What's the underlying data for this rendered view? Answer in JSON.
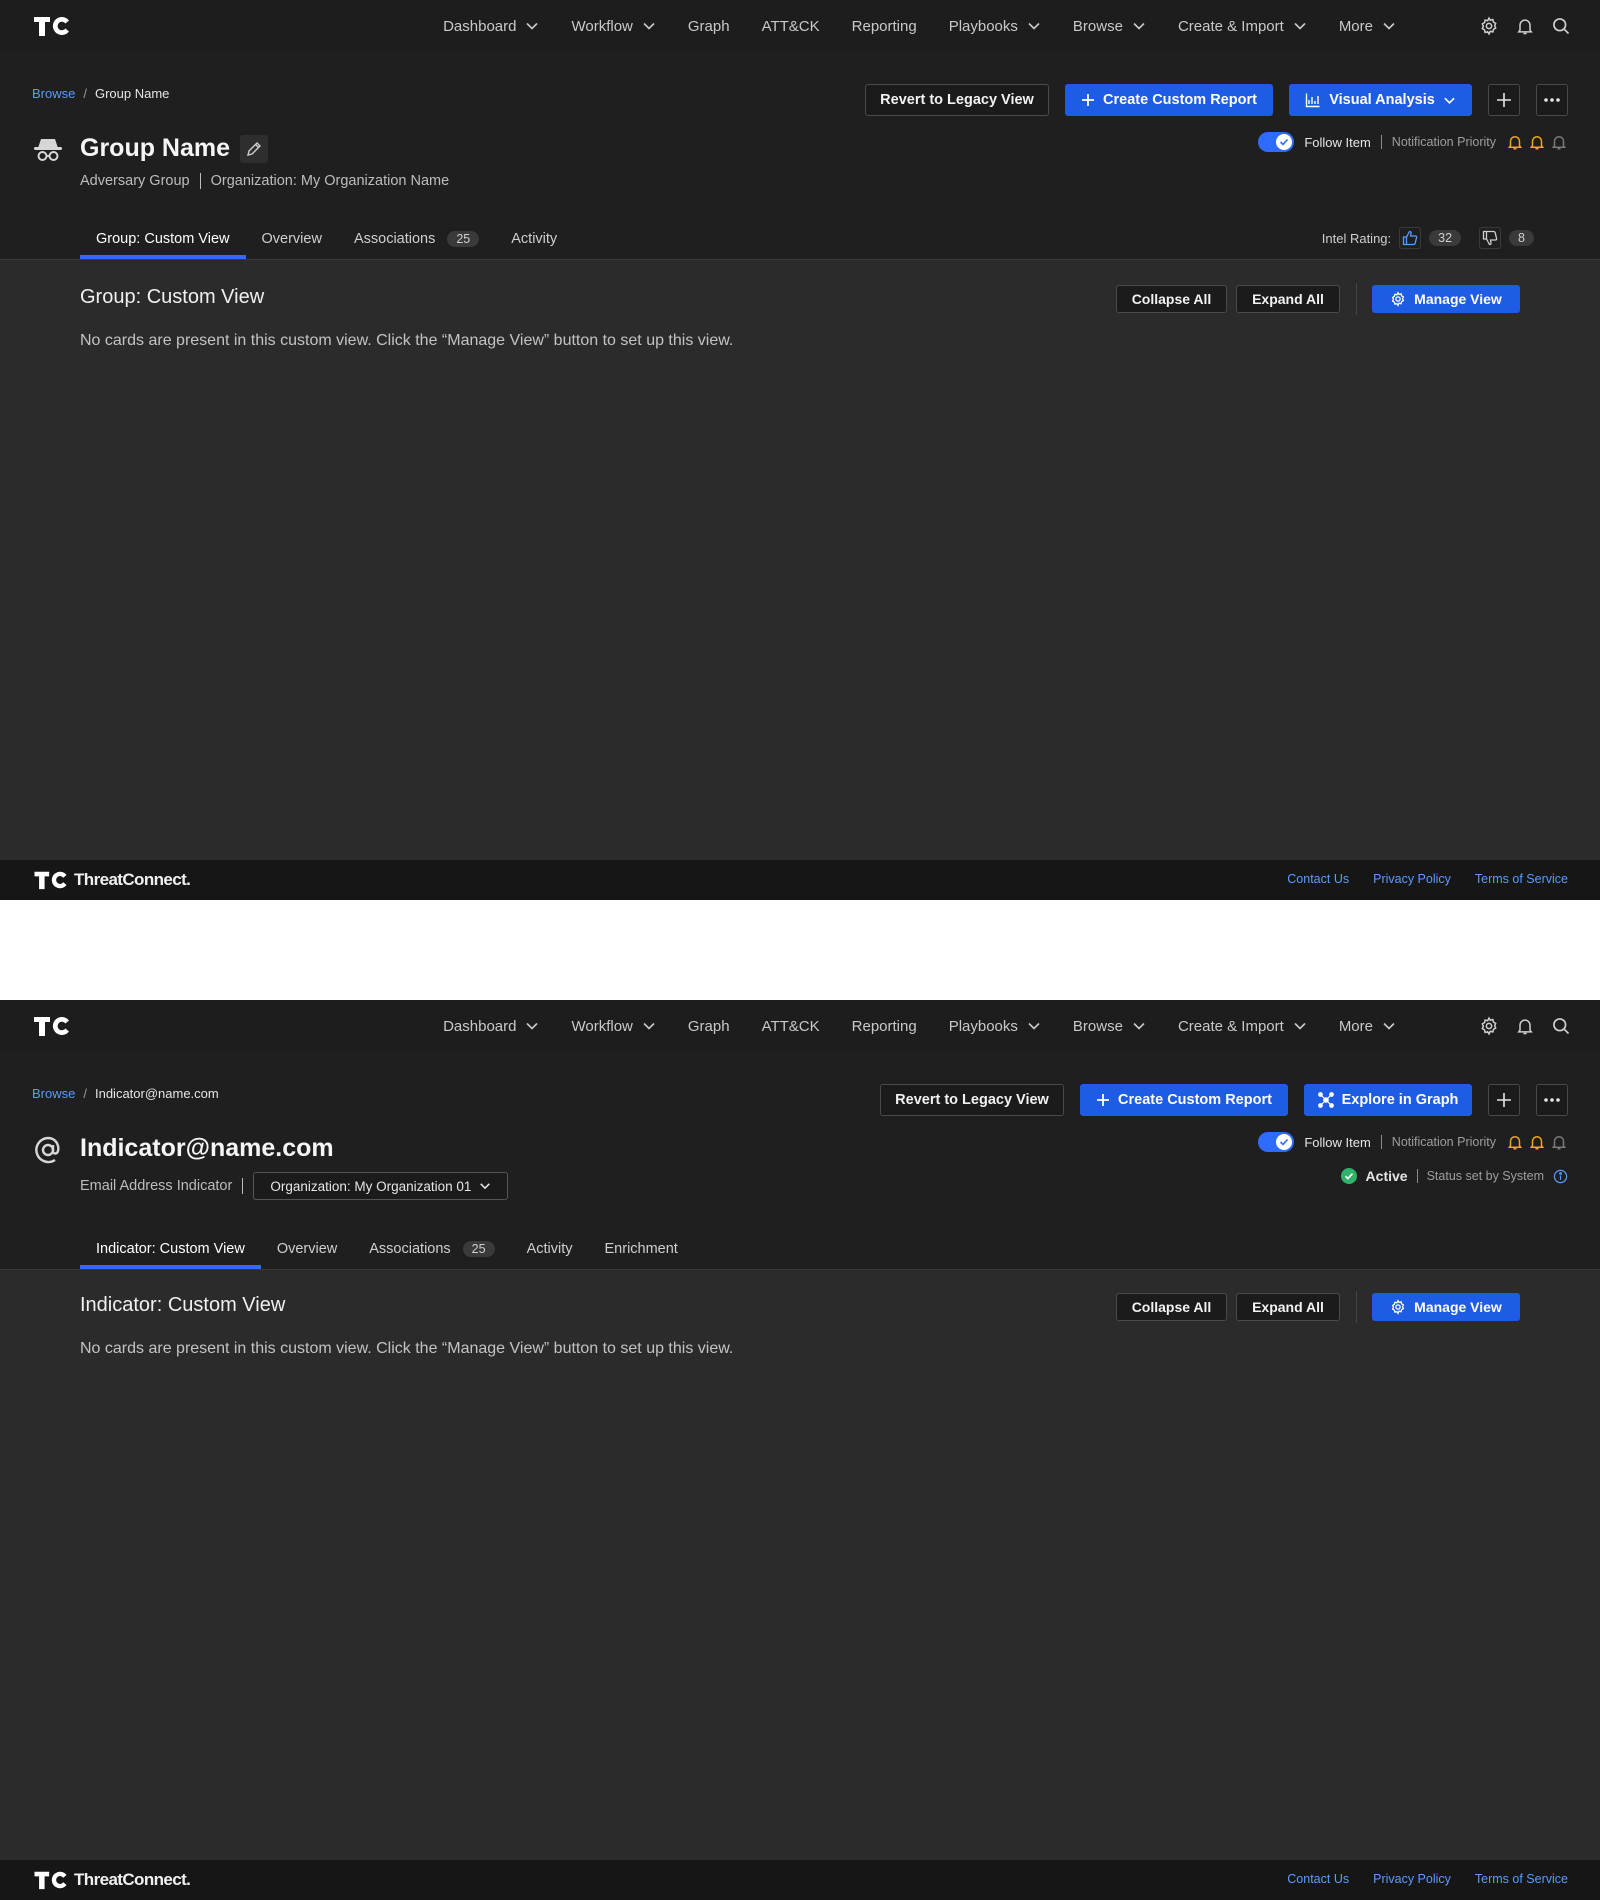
{
  "nav": {
    "items": [
      {
        "label": "Dashboard",
        "dropdown": true
      },
      {
        "label": "Workflow",
        "dropdown": true
      },
      {
        "label": "Graph",
        "dropdown": false
      },
      {
        "label": "ATT&CK",
        "dropdown": false
      },
      {
        "label": "Reporting",
        "dropdown": false
      },
      {
        "label": "Playbooks",
        "dropdown": true
      },
      {
        "label": "Browse",
        "dropdown": true
      },
      {
        "label": "Create & Import",
        "dropdown": true
      },
      {
        "label": "More",
        "dropdown": true
      }
    ],
    "icons": [
      "gear-icon",
      "bell-icon",
      "search-icon"
    ]
  },
  "screens": [
    {
      "breadcrumb": {
        "root": "Browse",
        "sep": "/",
        "current": "Group Name"
      },
      "buttons": {
        "legacy": "Revert to Legacy View",
        "create_report": "Create Custom Report",
        "secondary": "Visual Analysis"
      },
      "entity_icon": "spy-icon",
      "title": "Group Name",
      "subtitle": {
        "type": "Adversary Group",
        "org": "Organization: My Organization Name"
      },
      "follow": {
        "label": "Follow Item",
        "priority_label": "Notification Priority"
      },
      "tabs": [
        {
          "label": "Group: Custom View",
          "count": null,
          "active": true
        },
        {
          "label": "Overview",
          "count": null,
          "active": false
        },
        {
          "label": "Associations",
          "count": "25",
          "active": false
        },
        {
          "label": "Activity",
          "count": null,
          "active": false
        }
      ],
      "rating": {
        "label": "Intel Rating:",
        "up": "32",
        "down": "8"
      },
      "content": {
        "title": "Group: Custom View",
        "collapse": "Collapse All",
        "expand": "Expand All",
        "manage": "Manage View",
        "empty": "No cards are present in this custom view. Click the “Manage View” button to set up this view."
      }
    },
    {
      "breadcrumb": {
        "root": "Browse",
        "sep": "/",
        "current": "Indicator@name.com"
      },
      "buttons": {
        "legacy": "Revert to Legacy View",
        "create_report": "Create Custom Report",
        "secondary": "Explore in Graph"
      },
      "entity_icon": "at-sign-icon",
      "title": "Indicator@name.com",
      "subtitle": {
        "type": "Email Address Indicator",
        "org": "Organization: My Organization 01"
      },
      "follow": {
        "label": "Follow Item",
        "priority_label": "Notification Priority"
      },
      "status": {
        "label": "Active",
        "note": "Status set by System",
        "color": "#2fb36b"
      },
      "tabs": [
        {
          "label": "Indicator: Custom View",
          "count": null,
          "active": true
        },
        {
          "label": "Overview",
          "count": null,
          "active": false
        },
        {
          "label": "Associations",
          "count": "25",
          "active": false
        },
        {
          "label": "Activity",
          "count": null,
          "active": false
        },
        {
          "label": "Enrichment",
          "count": null,
          "active": false
        }
      ],
      "content": {
        "title": "Indicator: Custom View",
        "collapse": "Collapse All",
        "expand": "Expand All",
        "manage": "Manage View",
        "empty": "No cards are present in this custom view. Click the “Manage View” button to set up this view."
      }
    }
  ],
  "footer": {
    "brand": "ThreatConnect.",
    "links": [
      "Contact Us",
      "Privacy Policy",
      "Terms of Service"
    ]
  },
  "colors": {
    "accent": "#2f6bff",
    "primary_button": "#1f5ce6",
    "link": "#5b9bff",
    "bell_active": "#f2a51f",
    "bell_inactive": "#7a7a7a"
  }
}
